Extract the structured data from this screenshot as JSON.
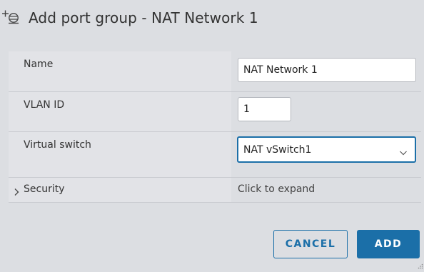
{
  "dialog": {
    "title": "Add port group - NAT Network 1",
    "title_icon": "add-port-group-icon"
  },
  "form": {
    "name": {
      "label": "Name",
      "value": "NAT Network 1"
    },
    "vlan": {
      "label": "VLAN ID",
      "value": "1"
    },
    "vswitch": {
      "label": "Virtual switch",
      "selected": "NAT vSwitch1",
      "icon": "chevron-down-icon"
    },
    "security": {
      "label": "Security",
      "value": "Click to expand",
      "icon": "chevron-right-icon"
    }
  },
  "buttons": {
    "cancel_label": "CANCEL",
    "add_label": "ADD"
  },
  "colors": {
    "accent": "#1b6fa8",
    "background": "#dcdee2",
    "label_cell": "#e2e3e7"
  }
}
